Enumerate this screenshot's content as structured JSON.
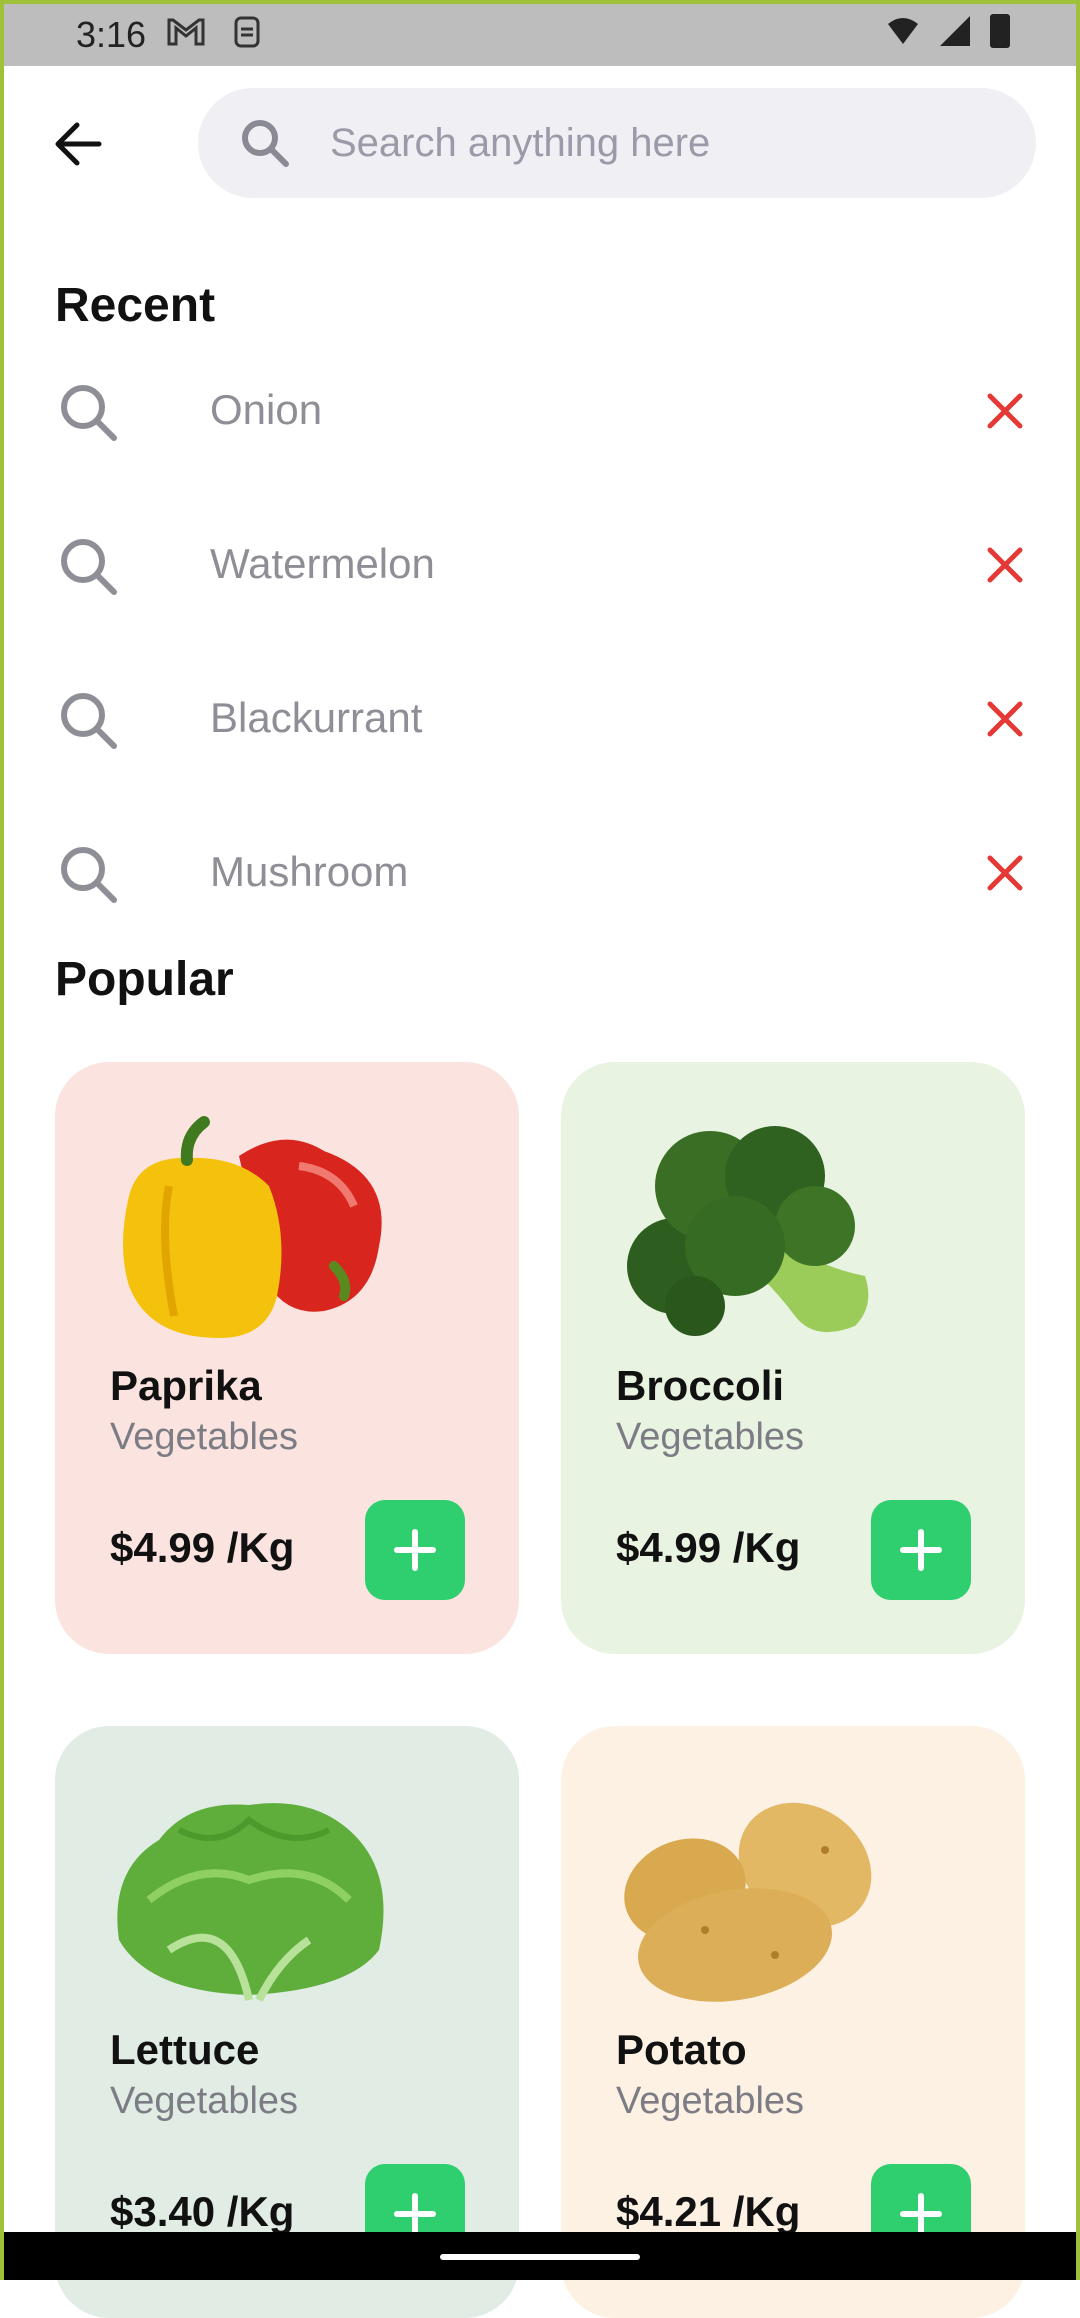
{
  "status_bar": {
    "time": "3:16",
    "notif_icons": [
      "gmail-icon",
      "sync-icon"
    ],
    "system_icons": [
      "wifi-icon",
      "signal-icon",
      "battery-icon"
    ]
  },
  "search": {
    "placeholder": "Search anything here"
  },
  "recent": {
    "title": "Recent",
    "items": [
      {
        "label": "Onion"
      },
      {
        "label": "Watermelon"
      },
      {
        "label": "Blackurrant"
      },
      {
        "label": "Mushroom"
      }
    ]
  },
  "popular": {
    "title": "Popular",
    "products": [
      {
        "name": "Paprika",
        "category": "Vegetables",
        "price": "$4.99 /Kg",
        "bg": "#fbe4e0",
        "image": "paprika"
      },
      {
        "name": "Broccoli",
        "category": "Vegetables",
        "price": "$4.99 /Kg",
        "bg": "#e9f3e1",
        "image": "broccoli"
      },
      {
        "name": "Lettuce",
        "category": "Vegetables",
        "price": "$3.40 /Kg",
        "bg": "#e1ece4",
        "image": "lettuce"
      },
      {
        "name": "Potato",
        "category": "Vegetables",
        "price": "$4.21 /Kg",
        "bg": "#fcf1e3",
        "image": "potato"
      }
    ]
  },
  "colors": {
    "accent_green": "#2fcf6f",
    "close_red": "#e53935",
    "muted_text": "#8e8e96"
  }
}
